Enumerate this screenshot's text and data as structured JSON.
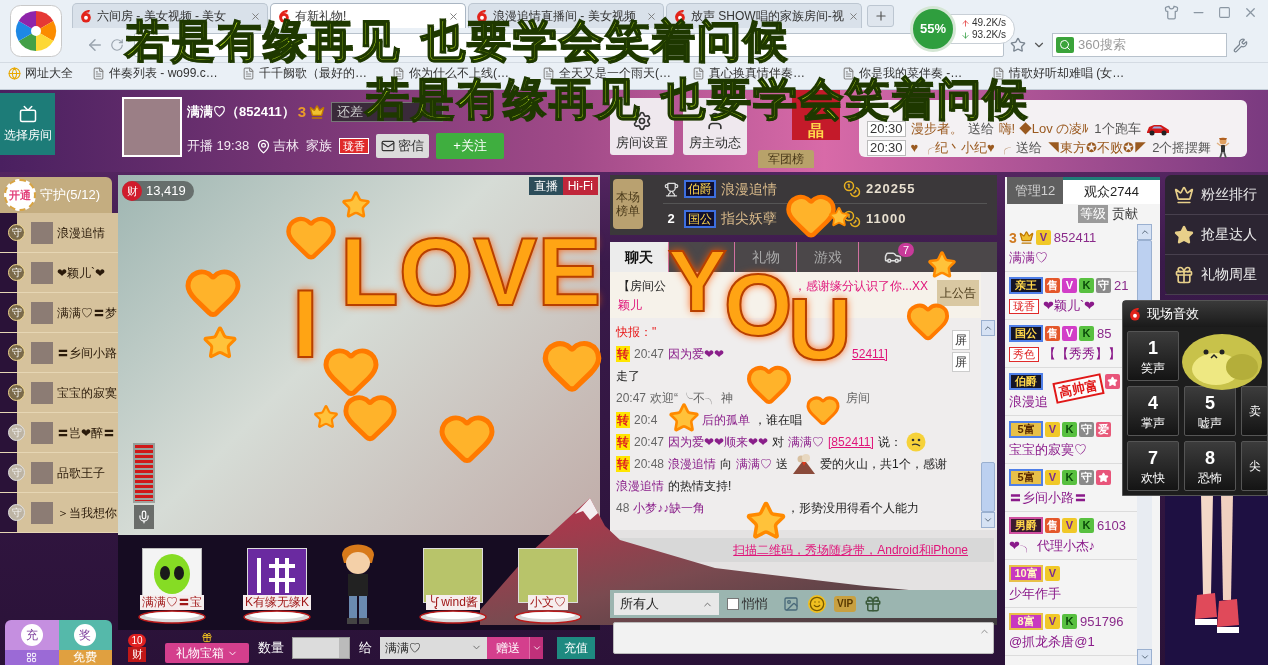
{
  "browser": {
    "tabs": [
      {
        "title": "六间房 - 美女视频 - 美女",
        "selected": false
      },
      {
        "title": "有新礼物!",
        "selected": true
      },
      {
        "title": "浪漫追情直播间 - 美女视频",
        "selected": false
      },
      {
        "title": "放声 SHOW唱的家族房间-视",
        "selected": false
      }
    ],
    "speed": {
      "percent": "55%",
      "upload": "49.2K/s",
      "download": "93.2K/s"
    },
    "search": {
      "placeholder": "360搜索"
    },
    "bookmarks": [
      "网址大全",
      "伴奏列表 - wo99.c…",
      "千千阙歌（最好的…",
      "你为什么不上线(…",
      "全天又是一个雨天(…",
      "真心换真情伴奏…",
      "你是我的菜伴奏 -…",
      "情歌好听却难唱 (女…"
    ]
  },
  "banner_texts": [
    [
      "若是有缘再见",
      "也要学会笑着问候"
    ],
    [
      "若是有缘再见",
      "也要学会笑着问候"
    ]
  ],
  "room": {
    "select_room": "选择房间",
    "host": {
      "name": "满满♡（852411）",
      "level": "3",
      "gap_label": "还差",
      "start": "开播 19:38",
      "location": "吉林",
      "family_label": "家族",
      "family_badge": "珑香",
      "message_button": "密信",
      "follow_button": "+关注"
    },
    "header_buttons": [
      {
        "kind": "settings",
        "label": "房间设置"
      },
      {
        "kind": "person",
        "label": "房主动态"
      }
    ],
    "flag": "晶",
    "legion_tab": "军团榜",
    "gift_ticker": [
      {
        "time": "20:30",
        "sender": "漫步者。",
        "verb": "送给",
        "receiver": "嗨! ◆Lov の凌ﾙ",
        "gift": "1个跑车",
        "kind": "car"
      },
      {
        "time": "20:30",
        "sender": "♥ ╭纪丶小纪♥ ╭",
        "verb": "送给",
        "receiver": "◥東方✪不败✪◤",
        "gift": "2个摇摆舞",
        "kind": "dancer"
      }
    ]
  },
  "guards": {
    "open_badge": "开通",
    "title": "守护(5/12)",
    "items": [
      {
        "badge": "守",
        "name": "浪漫追情",
        "online": true
      },
      {
        "badge": "守",
        "name": "❤颖儿`❤",
        "online": true
      },
      {
        "badge": "守",
        "name": "满满♡〓梦",
        "online": true
      },
      {
        "badge": "守",
        "name": "〓乡间小路",
        "online": true
      },
      {
        "badge": "守",
        "name": "宝宝的寂寞",
        "online": true
      },
      {
        "badge": "守",
        "name": "〓岂❤醉〓",
        "online": false
      },
      {
        "badge": "守",
        "name": "品歌王子",
        "online": false
      },
      {
        "badge": "守",
        "name": "＞当我想你",
        "online": false
      }
    ]
  },
  "side_tiles": [
    {
      "kind": "recharge",
      "label": "充"
    },
    {
      "kind": "prize",
      "label": "奖"
    },
    {
      "kind": "menu"
    },
    {
      "kind": "free",
      "label": "免费"
    }
  ],
  "video": {
    "wealth_badge": "财",
    "wealth": "13,419",
    "tags": [
      {
        "kind": "live",
        "label": "直播"
      },
      {
        "kind": "hifi",
        "label": "Hi-Fi"
      }
    ],
    "volume": {
      "level": 1
    }
  },
  "gift_stage": [
    {
      "kind": "alien",
      "label": "满满♡〓宝"
    },
    {
      "kind": "sign",
      "label": "K有缘无缘K"
    },
    {
      "kind": "boy"
    },
    {
      "kind": "photo",
      "label": "╰ᶘ wind酱"
    },
    {
      "kind": "photo",
      "label": "小文♡"
    }
  ],
  "gift_bar": {
    "wealth_count": "10",
    "wealth_badge": "财",
    "box_button": "礼物宝箱",
    "quantity_label": "数量",
    "to_label": "给",
    "recipient": "满满♡",
    "send_button": "赠送",
    "recharge_button": "充值"
  },
  "ranking": {
    "tag": "本场榜单",
    "rows": [
      {
        "kind": "trophy",
        "title": "伯爵",
        "name": "浪漫追情",
        "score": "220255"
      },
      {
        "kind": "number",
        "rank": "2",
        "title": "国公",
        "name": "指尖妖孽",
        "score": "11000"
      }
    ]
  },
  "chat_tabs": [
    {
      "kind": "text",
      "label": "聊天",
      "selected": true
    },
    {
      "kind": "covered"
    },
    {
      "kind": "text",
      "label": "礼物",
      "selected": false
    },
    {
      "kind": "text",
      "label": "游戏",
      "selected": false
    },
    {
      "kind": "car",
      "badge": "7",
      "selected": false
    }
  ],
  "announcement": {
    "parts": [
      {
        "kind": "heading",
        "text": "【房间公"
      },
      {
        "kind": "gap4"
      },
      {
        "kind": "notice",
        "text": "，感谢缘分认识了你...XX"
      }
    ],
    "line2": "颖儿",
    "button": "上公告"
  },
  "messages": [
    {
      "parts": [
        {
          "kind": "flash",
          "text": "快报：\""
        }
      ]
    },
    {
      "relay": "转",
      "parts": [
        {
          "kind": "time",
          "text": "20:47"
        },
        {
          "kind": "name",
          "text": "因为爱❤❤"
        },
        {
          "kind": "gap4"
        },
        {
          "kind": "link",
          "text": "52411]"
        }
      ]
    },
    {
      "parts": [
        {
          "kind": "plain",
          "text": "走了"
        }
      ]
    },
    {
      "parts": [
        {
          "kind": "time",
          "text": "20:47"
        },
        {
          "kind": "system",
          "text": "欢迎“ ╰不╮ 神"
        },
        {
          "kind": "gap3"
        },
        {
          "kind": "system",
          "text": "房间"
        }
      ]
    },
    {
      "relay": "转",
      "parts": [
        {
          "kind": "time",
          "text": "20:4"
        },
        {
          "kind": "gap1"
        },
        {
          "kind": "name",
          "text": "后的孤单"
        },
        {
          "kind": "plain",
          "text": "，谁在唱"
        }
      ]
    },
    {
      "relay": "转",
      "parts": [
        {
          "kind": "time",
          "text": "20:47"
        },
        {
          "kind": "name",
          "text": "因为爱❤❤顺来❤❤"
        },
        {
          "kind": "plain",
          "text": "对"
        },
        {
          "kind": "name",
          "text": "满满♡"
        },
        {
          "kind": "link",
          "text": "[852411]"
        },
        {
          "kind": "plain",
          "text": "说："
        },
        {
          "kind": "emoji"
        }
      ]
    },
    {
      "relay": "转",
      "parts": [
        {
          "kind": "time",
          "text": "20:48"
        },
        {
          "kind": "name",
          "text": "浪漫追情"
        },
        {
          "kind": "plain",
          "text": "向"
        },
        {
          "kind": "name",
          "text": "满满♡"
        },
        {
          "kind": "plain",
          "text": "送"
        },
        {
          "kind": "volcano"
        },
        {
          "kind": "plain",
          "text": "爱的火山，共1个，感谢"
        }
      ]
    },
    {
      "parts": [
        {
          "kind": "name",
          "text": "浪漫追情"
        },
        {
          "kind": "plain",
          "text": "的热情支持!"
        }
      ]
    },
    {
      "parts": [
        {
          "kind": "time",
          "text": "48"
        },
        {
          "kind": "name",
          "text": "小梦♪♪缺一角"
        },
        {
          "kind": "gap2"
        },
        {
          "kind": "plain",
          "text": "，形势没用得看个人能力"
        }
      ]
    }
  ],
  "chat_tools": [
    "屏",
    "屏"
  ],
  "ad_link": "扫描二维码，秀场随身带，Android和iPhone",
  "chat_input": {
    "target": "所有人",
    "whisper": {
      "label": "悄悄",
      "checked": false
    },
    "vip": "VIP"
  },
  "viewers": {
    "tabs": [
      {
        "label": "管理12",
        "selected": false
      },
      {
        "label": "观众2744",
        "selected": true
      }
    ],
    "sort": [
      {
        "label": "等级",
        "selected": true
      },
      {
        "label": "贡献",
        "selected": false
      }
    ],
    "items": [
      {
        "rank": {
          "kind": "crown",
          "label": "3"
        },
        "tags": [
          {
            "kind": "vip",
            "label": "V"
          }
        ],
        "id": "852411",
        "name": "满满♡"
      },
      {
        "rank": {
          "kind": "noble",
          "label": "亲王"
        },
        "tags": [
          {
            "kind": "sell",
            "label": "售"
          },
          {
            "kind": "svip",
            "label": "V"
          },
          {
            "kind": "k",
            "label": "K"
          },
          {
            "kind": "guard",
            "label": "守"
          }
        ],
        "id": "21",
        "family": "珑香",
        "name": "❤颖儿`❤"
      },
      {
        "rank": {
          "kind": "noble",
          "label": "国公"
        },
        "tags": [
          {
            "kind": "sell",
            "label": "售"
          },
          {
            "kind": "svip",
            "label": "V"
          },
          {
            "kind": "k",
            "label": "K"
          }
        ],
        "id": "85",
        "family": "秀色",
        "name": "【【秀秀】】"
      },
      {
        "rank": {
          "kind": "noble",
          "label": "伯爵"
        },
        "tags": [
          {
            "kind": "covered"
          },
          {
            "kind": "covered"
          },
          {
            "kind": "covered"
          },
          {
            "kind": "star"
          }
        ],
        "name": "浪漫追"
      },
      {
        "rank": {
          "kind": "rich",
          "label": "5富"
        },
        "tags": [
          {
            "kind": "vip",
            "label": "V"
          },
          {
            "kind": "k",
            "label": "K"
          },
          {
            "kind": "guard",
            "label": "守"
          },
          {
            "kind": "love",
            "label": "爱"
          }
        ],
        "name": "宝宝的寂寞♡"
      },
      {
        "rank": {
          "kind": "rich",
          "label": "5富"
        },
        "tags": [
          {
            "kind": "vip",
            "label": "V"
          },
          {
            "kind": "k",
            "label": "K"
          },
          {
            "kind": "guard",
            "label": "守"
          },
          {
            "kind": "star"
          }
        ],
        "name": "〓乡间小路〓"
      },
      {
        "rank": {
          "kind": "baron",
          "label": "男爵"
        },
        "tags": [
          {
            "kind": "sell",
            "label": "售"
          },
          {
            "kind": "vip",
            "label": "V"
          },
          {
            "kind": "k",
            "label": "K"
          }
        ],
        "id": "6103",
        "name": "❤╮ 代理小杰♪"
      },
      {
        "rank": {
          "kind": "pink",
          "label": "10富"
        },
        "tags": [
          {
            "kind": "vip",
            "label": "V"
          }
        ],
        "name": "少年作手"
      },
      {
        "rank": {
          "kind": "pink",
          "label": "8富"
        },
        "tags": [
          {
            "kind": "vip",
            "label": "V"
          },
          {
            "kind": "k",
            "label": "K"
          }
        ],
        "id": "951796",
        "name": "@抓龙杀唐@1"
      }
    ]
  },
  "stamp": "高帅富",
  "fan_menu": [
    {
      "kind": "crown",
      "label": "粉丝排行"
    },
    {
      "kind": "star",
      "label": "抢星达人"
    },
    {
      "kind": "gift",
      "label": "礼物周星"
    }
  ],
  "sound_panel": {
    "title": "现场音效",
    "keys": [
      {
        "kind": "key",
        "number": "1",
        "label": "笑声"
      },
      {
        "kind": "covered"
      },
      {
        "kind": "covered"
      },
      {
        "kind": "key",
        "number": "4",
        "label": "掌声"
      },
      {
        "kind": "key",
        "number": "5",
        "label": "嘘声"
      },
      {
        "kind": "key",
        "label": "卖"
      },
      {
        "kind": "key",
        "number": "7",
        "label": "欢快"
      },
      {
        "kind": "key",
        "number": "8",
        "label": "恐怖"
      },
      {
        "kind": "key",
        "label": "尖"
      }
    ]
  },
  "gift_effect": {
    "words": [
      "I",
      "LOVE",
      "Y",
      "O",
      "U"
    ]
  }
}
